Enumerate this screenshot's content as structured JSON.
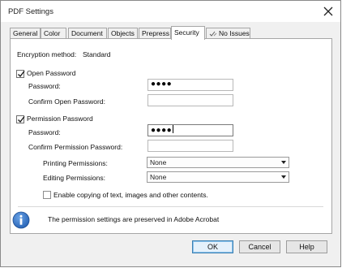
{
  "window": {
    "title": "PDF Settings"
  },
  "tabs": [
    {
      "label": "General"
    },
    {
      "label": "Color"
    },
    {
      "label": "Document"
    },
    {
      "label": "Objects"
    },
    {
      "label": "Prepress"
    },
    {
      "label": "Security"
    },
    {
      "label": "No Issues"
    }
  ],
  "security": {
    "encryption_method_label": "Encryption method:",
    "encryption_method_value": "Standard",
    "open_password": {
      "checkbox_label": "Open Password",
      "checked": true,
      "password_label": "Password:",
      "password_value": "●●●●",
      "confirm_label": "Confirm Open Password:",
      "confirm_value": ""
    },
    "permission_password": {
      "checkbox_label": "Permission Password",
      "checked": true,
      "password_label": "Password:",
      "password_value": "●●●●",
      "confirm_label": "Confirm Permission Password:",
      "confirm_value": ""
    },
    "printing_permissions": {
      "label": "Printing Permissions:",
      "selected": "None"
    },
    "editing_permissions": {
      "label": "Editing Permissions:",
      "selected": "None"
    },
    "enable_copying": {
      "label": "Enable copying of text, images and other contents.",
      "checked": false
    }
  },
  "info": {
    "message": "The permission settings are preserved in Adobe Acrobat",
    "icon": "info-icon"
  },
  "buttons": {
    "ok": "OK",
    "cancel": "Cancel",
    "help": "Help"
  },
  "colors": {
    "info_blue": "#2a66b8",
    "default_button_border": "#3c7fb1"
  }
}
